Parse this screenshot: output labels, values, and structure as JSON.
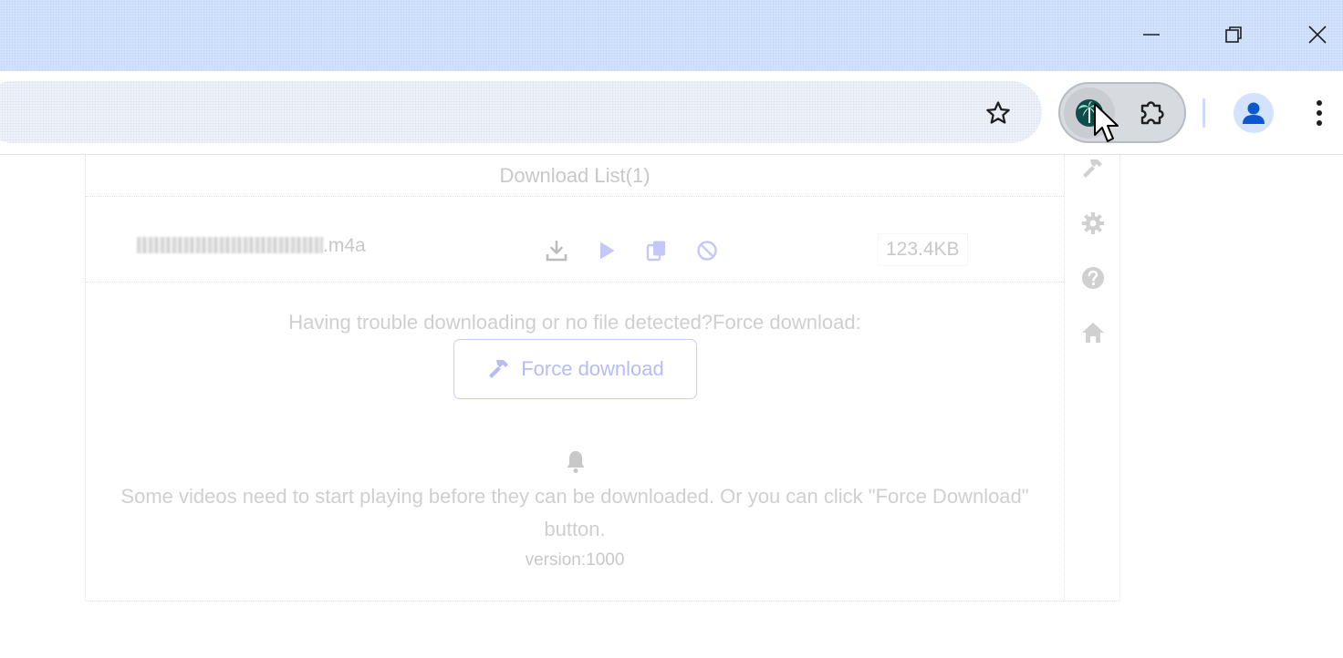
{
  "window_controls": {
    "minimize_icon": "minimize-icon",
    "restore_icon": "restore-icon",
    "close_icon": "close-icon"
  },
  "toolbar": {
    "bookmark_icon": "star-icon",
    "extension_icon": "palm-tree-icon",
    "extensions_menu_icon": "puzzle-icon",
    "profile_icon": "person-icon",
    "menu_icon": "vertical-dots-icon"
  },
  "popup": {
    "list_header": "Download List(1)",
    "file": {
      "name_suffix": ".m4a",
      "size": "123.4KB",
      "actions": [
        "download-icon",
        "play-icon",
        "copy-icon",
        "block-icon"
      ]
    },
    "trouble_text": "Having trouble downloading or no file detected?Force download:",
    "force_button_label": "Force download",
    "note_text": "Some videos need to start playing before they can be downloaded. Or you can click \"Force Download\" button.",
    "version_text": "version:1000",
    "side_icons": [
      "hammer-icon",
      "gear-icon",
      "help-icon",
      "home-icon"
    ]
  },
  "colors": {
    "titlebar": "#d3e3fd",
    "accent": "#b6bcf5",
    "muted_text": "#c8c8c8",
    "avatar": "#0b57d0"
  }
}
